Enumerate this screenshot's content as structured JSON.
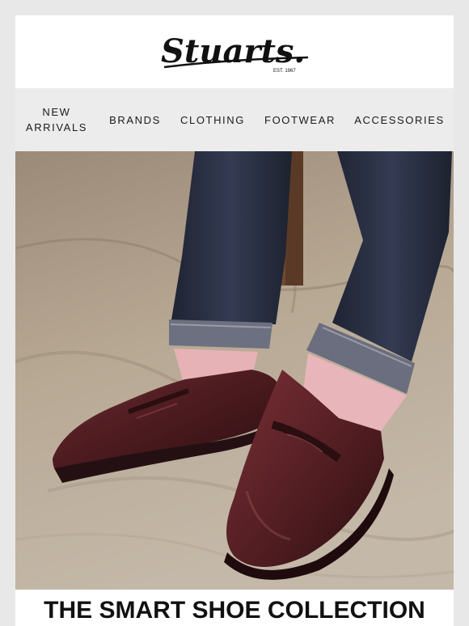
{
  "brand": {
    "logo_text": "Stuarts.",
    "tagline": "EST. 1967"
  },
  "nav": {
    "items": [
      {
        "label": "NEW ARRIVALS",
        "line1": "NEW",
        "line2": "ARRIVALS"
      },
      {
        "label": "BRANDS"
      },
      {
        "label": "CLOTHING"
      },
      {
        "label": "FOOTWEAR"
      },
      {
        "label": "ACCESSORIES"
      }
    ]
  },
  "hero": {
    "subject": "burgundy penny loafers with pink socks and raw denim jeans"
  },
  "headline": {
    "text": "THE SMART SHOE COLLECTION"
  },
  "colors": {
    "page_bg": "#e8e8e8",
    "nav_bg": "#ececec",
    "text": "#1a1a1a",
    "backdrop": "#b4a594",
    "denim": "#2a3042",
    "leather": "#4a1a1e",
    "sock": "#e8b4b8"
  }
}
